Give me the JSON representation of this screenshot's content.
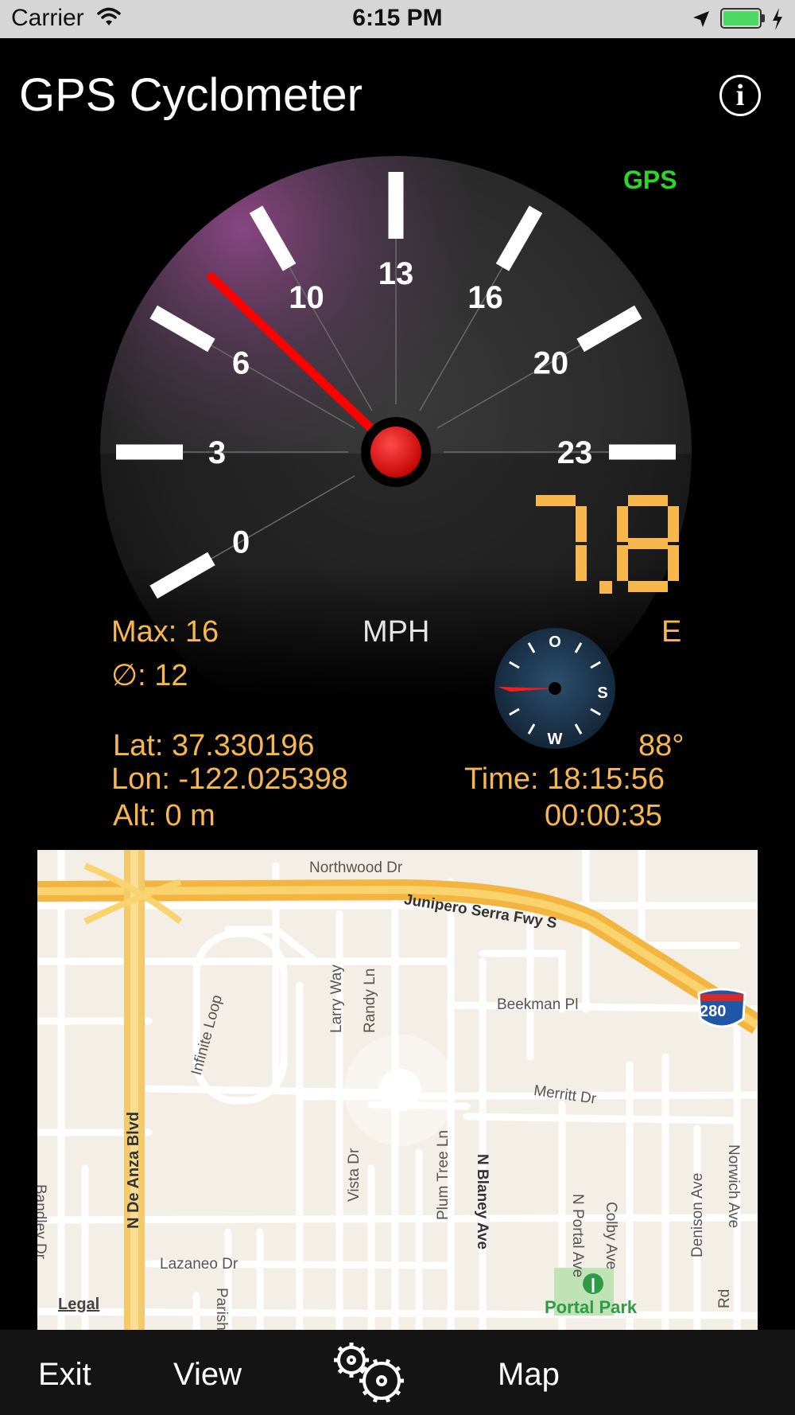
{
  "status_bar": {
    "carrier": "Carrier",
    "time": "6:15 PM",
    "battery_level": 1.0,
    "battery_color": "#4cd964"
  },
  "app": {
    "title": "GPS Cyclometer",
    "gps_indicator": "GPS",
    "gps_color": "#2bd629"
  },
  "speedometer": {
    "scale_labels": [
      "0",
      "3",
      "6",
      "10",
      "13",
      "16",
      "20",
      "23"
    ],
    "needle_value": 7.8,
    "speed_readout": "7.8",
    "unit": "MPH",
    "accent": "#f7b74d",
    "needle_color": "#ff0000"
  },
  "stats": {
    "max": "Max: 16",
    "average": "∅: 12",
    "heading_dir": "E",
    "heading_deg": "88°",
    "latitude": "Lat: 37.330196",
    "longitude": "Lon: -122.025398",
    "altitude": "Alt: 0 m",
    "clock_time": "Time: 18:15:56",
    "elapsed": "00:00:35"
  },
  "compass": {
    "labels": [
      "O",
      "S",
      "W"
    ],
    "needle_color": "#ff1a1a"
  },
  "map": {
    "streets": {
      "northwood": "Northwood Dr",
      "junipero": "Junipero Serra Fwy S",
      "beekman": "Beekman Pl",
      "merritt": "Merritt Dr",
      "lazaneo": "Lazaneo Dr",
      "infinite": "Infinite Loop",
      "larry": "Larry Way",
      "randy": "Randy Ln",
      "bandley": "Bandley Dr",
      "deanza": "N De Anza Blvd",
      "vista": "Vista Dr",
      "plumtree": "Plum Tree Ln",
      "blaney": "N Blaney Ave",
      "portal": "N Portal Ave",
      "colby": "Colby Ave",
      "denison": "Denison Ave",
      "norwich": "Norwich Ave",
      "parish": "Parish P",
      "rd": "Rd"
    },
    "highway_shield": "280",
    "park": "Portal Park",
    "legal": "Legal"
  },
  "toolbar": {
    "exit": "Exit",
    "view": "View",
    "map": "Map",
    "settings_icon": "gears-icon"
  }
}
